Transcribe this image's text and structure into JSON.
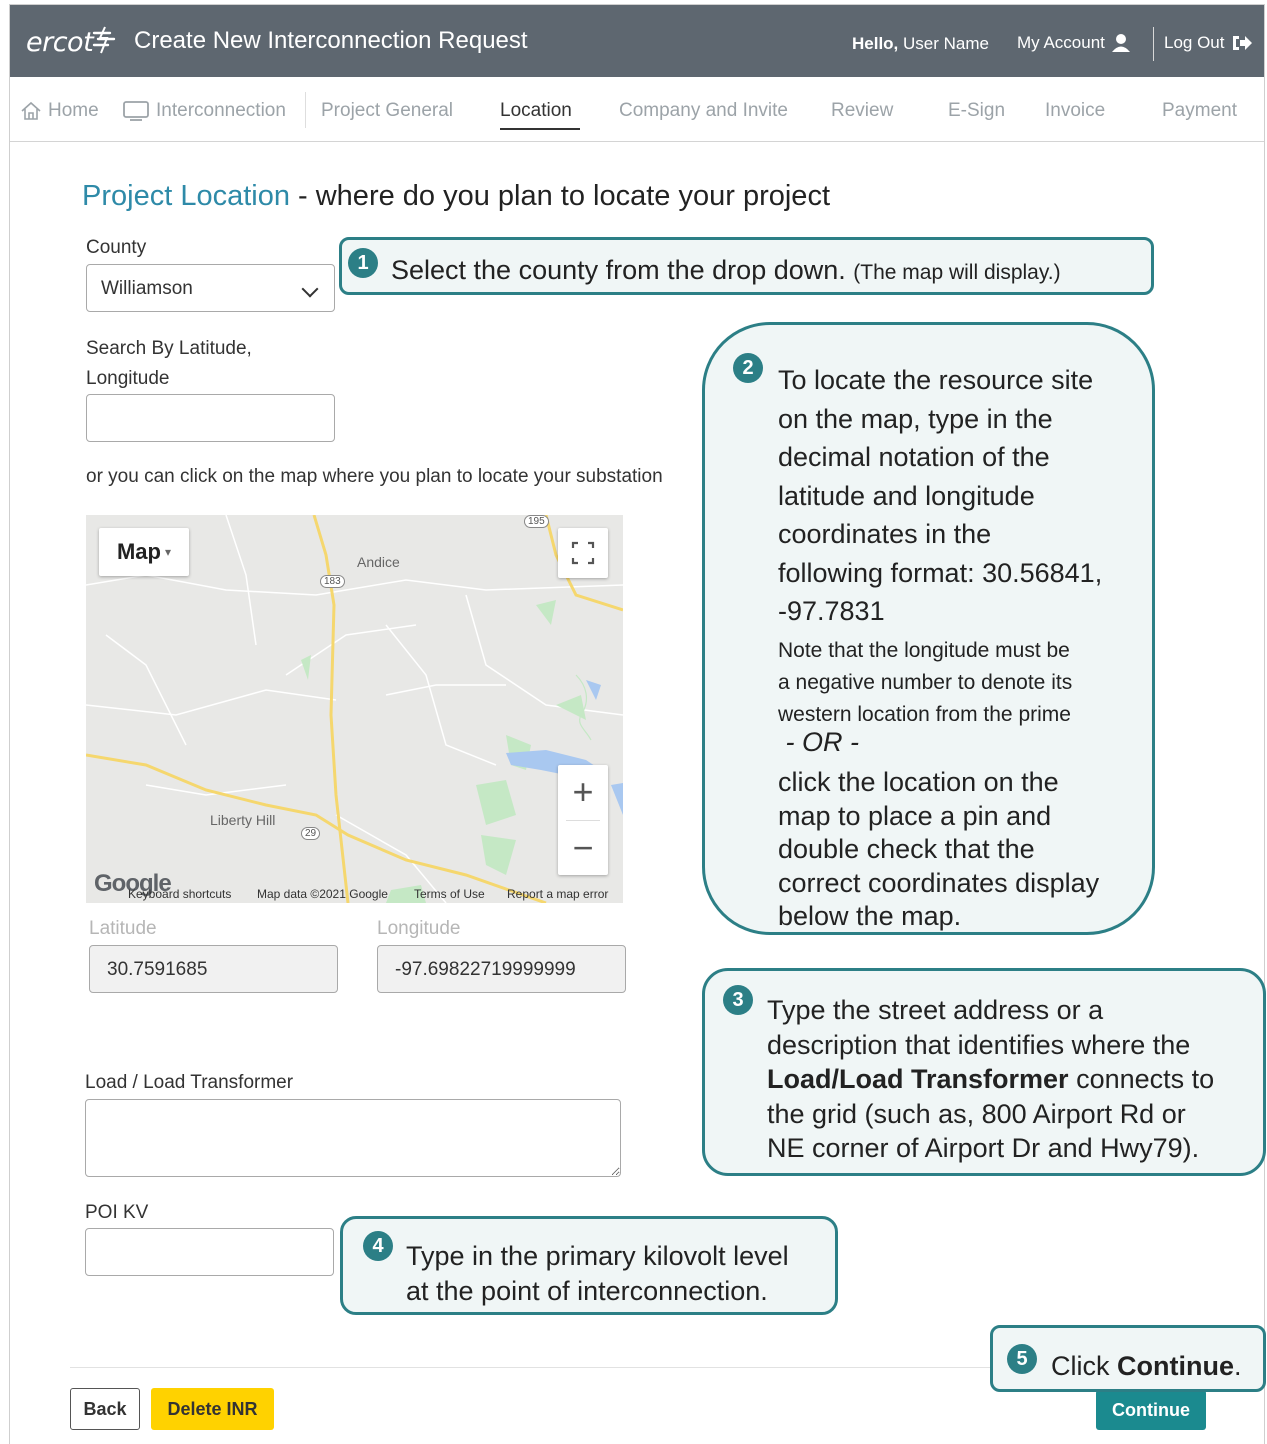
{
  "header": {
    "logo": "ercot",
    "title": "Create New Interconnection Request",
    "hello_prefix": "Hello,",
    "user_name": "User Name",
    "my_account": "My Account",
    "log_out": "Log Out"
  },
  "nav": {
    "home": "Home",
    "interconnection": "Interconnection",
    "tabs": [
      "Project General",
      "Location",
      "Company and Invite",
      "Review",
      "E-Sign",
      "Invoice",
      "Payment"
    ],
    "active_tab": "Location"
  },
  "page": {
    "heading_highlight": "Project Location",
    "heading_rest": " - where do you plan to locate your project"
  },
  "form": {
    "county_label": "County",
    "county_value": "Williamson",
    "latlong_label_1": "Search By Latitude,",
    "latlong_label_2": "Longitude",
    "latlong_value": "",
    "map_hint": "or you can click on the map where you plan to locate your substation",
    "latitude_label": "Latitude",
    "latitude_value": "30.7591685",
    "longitude_label": "Longitude",
    "longitude_value": "-97.69822719999999",
    "load_label": "Load / Load Transformer",
    "load_value": "",
    "poi_label": "POI KV",
    "poi_value": ""
  },
  "map": {
    "type_label": "Map",
    "place_andice": "Andice",
    "place_liberty_hill": "Liberty Hill",
    "shield_183": "183",
    "shield_29": "29",
    "shield_195": "195",
    "zoom_in": "+",
    "zoom_out": "−",
    "google": "Google",
    "footer": {
      "shortcuts": "Keyboard shortcuts",
      "map_data": "Map data ©2021 Google",
      "terms": "Terms of Use",
      "report": "Report a map error"
    },
    "colors": {
      "land": "#e8e8e6",
      "highway": "#f5d76e",
      "water": "#a9c8f0",
      "park": "#c5e8c5"
    }
  },
  "buttons": {
    "back": "Back",
    "delete": "Delete INR",
    "continue": "Continue"
  },
  "callouts": {
    "c1": {
      "num": "1",
      "text": "Select the county from the drop down.",
      "small": "(The map will display.)"
    },
    "c2": {
      "num": "2",
      "lines": [
        "To locate the resource site",
        "on the map, type in the",
        "decimal notation of the",
        "latitude and longitude",
        "coordinates in the",
        "following format: 30.56841,",
        "-97.7831"
      ],
      "note_lines": [
        "Note that the longitude must be",
        "a negative number to denote its",
        "western location from the prime"
      ],
      "or": " - OR -",
      "click_lines": [
        "click the location on the",
        "map to place a pin and",
        "double check that the",
        "correct coordinates display",
        "below the map."
      ]
    },
    "c3": {
      "num": "3",
      "line1": "Type the street address or a",
      "line2": "description that identifies where the",
      "bold": "Load/Load Transformer",
      "line3_rest": " connects to",
      "line4": "the grid (such as, 800 Airport Rd or",
      "line5": "NE corner of Airport Dr and Hwy79)."
    },
    "c4": {
      "num": "4",
      "line1": "Type in the primary kilovolt level",
      "line2": "at the point of interconnection."
    },
    "c5": {
      "num": "5",
      "prefix": "Click ",
      "bold": "Continue",
      "suffix": "."
    }
  },
  "colors": {
    "header_bg": "#5e6770",
    "accent_blue": "#2e8aa8",
    "callout_border": "#2c7f86",
    "continue_bg": "#1b8a8f",
    "delete_bg": "#ffd200"
  }
}
